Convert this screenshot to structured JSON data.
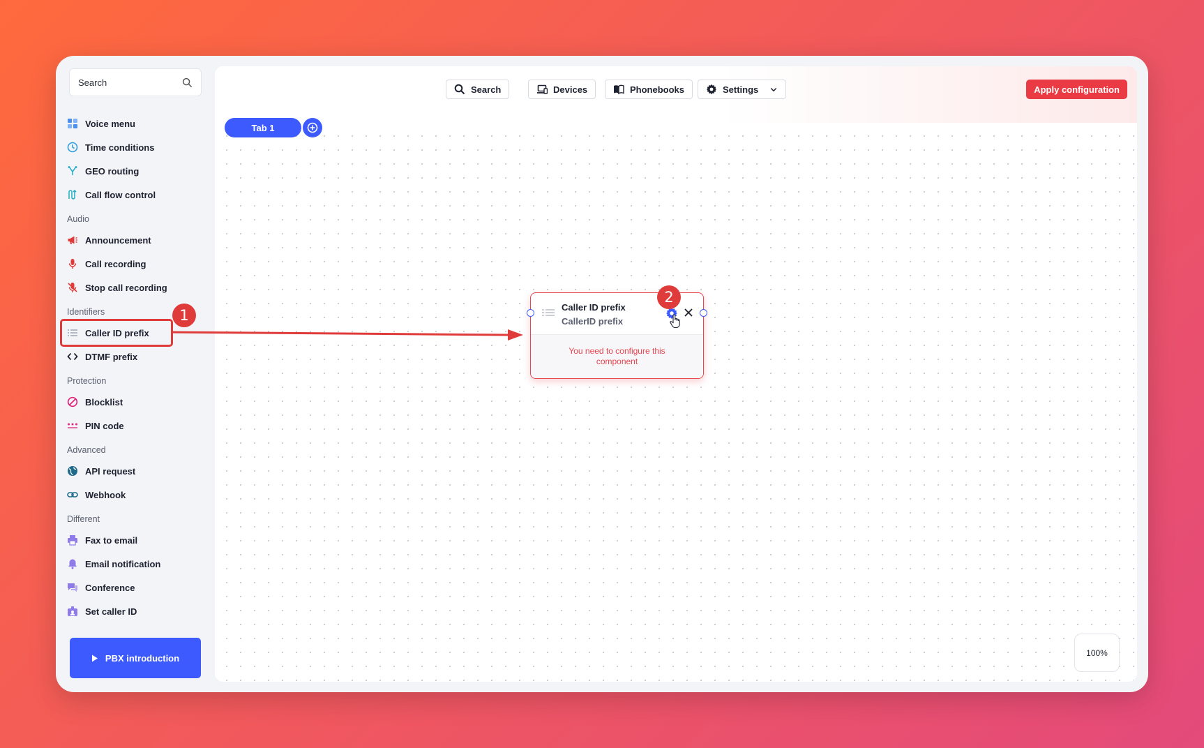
{
  "sidebar": {
    "search_placeholder": "Search",
    "items_top": [
      {
        "label": "Voice menu",
        "icon": "grid-icon",
        "color": "#4a8ef0"
      },
      {
        "label": "Time conditions",
        "icon": "clock-icon",
        "color": "#2f9fe0"
      },
      {
        "label": "GEO routing",
        "icon": "branch-icon",
        "color": "#2bb0c9"
      },
      {
        "label": "Call flow control",
        "icon": "flow-icon",
        "color": "#2bb0c9"
      }
    ],
    "sections": [
      {
        "title": "Audio",
        "items": [
          {
            "label": "Announcement",
            "icon": "megaphone-icon",
            "color": "#e03b3b"
          },
          {
            "label": "Call recording",
            "icon": "microphone-icon",
            "color": "#e03b3b"
          },
          {
            "label": "Stop call recording",
            "icon": "microphone-off-icon",
            "color": "#e03b3b"
          }
        ]
      },
      {
        "title": "Identifiers",
        "items": [
          {
            "label": "Caller ID prefix",
            "icon": "list-icon",
            "color": "#8a8fa0"
          },
          {
            "label": "DTMF prefix",
            "icon": "code-icon",
            "color": "#1e2230"
          }
        ]
      },
      {
        "title": "Protection",
        "items": [
          {
            "label": "Blocklist",
            "icon": "block-icon",
            "color": "#e0257a"
          },
          {
            "label": "PIN code",
            "icon": "dots-icon",
            "color": "#e0257a"
          }
        ]
      },
      {
        "title": "Advanced",
        "items": [
          {
            "label": "API request",
            "icon": "globe-icon",
            "color": "#1f6a8a"
          },
          {
            "label": "Webhook",
            "icon": "link-icon",
            "color": "#1f6a8a"
          }
        ]
      },
      {
        "title": "Different",
        "items": [
          {
            "label": "Fax to email",
            "icon": "printer-icon",
            "color": "#8e7be8"
          },
          {
            "label": "Email notification",
            "icon": "bell-icon",
            "color": "#8e7be8"
          },
          {
            "label": "Conference",
            "icon": "chat-icon",
            "color": "#8e7be8"
          },
          {
            "label": "Set caller ID",
            "icon": "id-badge-icon",
            "color": "#8e7be8"
          }
        ]
      }
    ],
    "pbx_button": "PBX introduction"
  },
  "toolbar": {
    "search": "Search",
    "devices": "Devices",
    "phonebooks": "Phonebooks",
    "settings": "Settings",
    "apply": "Apply configuration"
  },
  "tabs": [
    {
      "label": "Tab 1"
    }
  ],
  "node": {
    "title": "Caller ID prefix",
    "subtitle": "CallerID prefix",
    "warning": "You need to configure this component"
  },
  "zoom": "100%",
  "annotations": {
    "badge_1": "1",
    "badge_2": "2"
  },
  "colors": {
    "accent": "#3d5afe",
    "danger": "#ea3b45"
  }
}
